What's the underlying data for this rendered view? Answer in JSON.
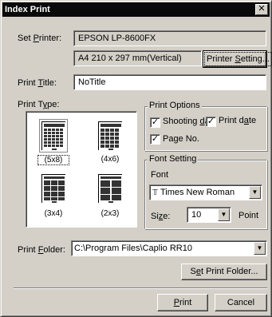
{
  "window": {
    "title": "Index Print",
    "close_icon": "close-icon"
  },
  "set_printer": {
    "label_pre": "Set ",
    "label_u": "P",
    "label_post": "rinter:",
    "printer_name": "EPSON LP-8600FX",
    "paper": "A4 210 x 297 mm(Vertical)",
    "setting_button": {
      "pre": "Printer ",
      "u": "S",
      "post": "etting..."
    }
  },
  "print_title": {
    "label_pre": "Print ",
    "label_u": "T",
    "label_post": "itle:",
    "value": "NoTitle"
  },
  "print_type": {
    "label_pre": "Print T",
    "label_u": "y",
    "label_post": "pe:",
    "options": [
      {
        "label": "(5x8)",
        "selected": true
      },
      {
        "label": "(4x6)",
        "selected": false
      },
      {
        "label": "(3x4)",
        "selected": false
      },
      {
        "label": "(2x3)",
        "selected": false
      }
    ]
  },
  "print_options": {
    "title": "Print Options",
    "shooting_date": {
      "pre": "Shooting ",
      "u": "d",
      "post": "a",
      "checked": true
    },
    "print_date": {
      "pre": "Print d",
      "u": "a",
      "post": "te",
      "checked": true
    },
    "page_no": {
      "pre": "Pa",
      "u": "g",
      "post": "e No.",
      "checked": true
    }
  },
  "font_setting": {
    "title": "Font Setting",
    "font_label": "Font",
    "font_value": "Times New Roman",
    "font_icon": "truetype-font-icon",
    "size_label_pre": "Si",
    "size_label_u": "z",
    "size_label_post": "e:",
    "size_value": "10",
    "size_unit": "Point"
  },
  "print_folder": {
    "label_pre": "Print ",
    "label_u": "F",
    "label_post": "older:",
    "value": "C:\\Program Files\\Caplio RR10",
    "set_button": {
      "pre": "S",
      "u": "e",
      "post": "t Print Folder..."
    }
  },
  "actions": {
    "print": {
      "u": "P",
      "post": "rint"
    },
    "cancel": "Cancel"
  }
}
